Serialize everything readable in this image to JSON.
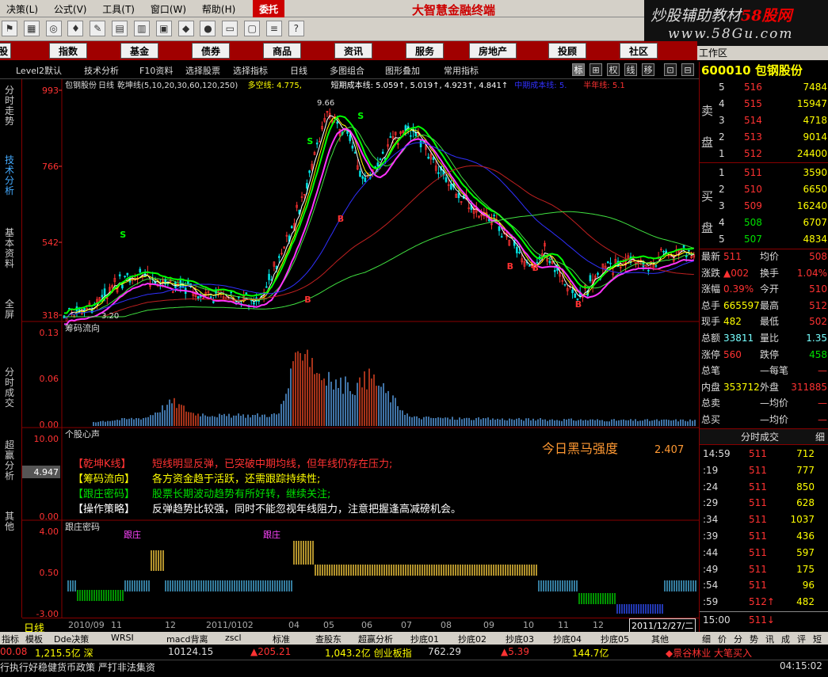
{
  "menu": {
    "items": [
      "决策(L)",
      "公式(V)",
      "工具(T)",
      "窗口(W)",
      "帮助(H)"
    ],
    "entrust": "委托",
    "app_title": "大智慧金融终端"
  },
  "watermark": {
    "line1_a": "炒股辅助教材",
    "line1_b": "58股网",
    "line2": "www.58Gu.com"
  },
  "catbar": {
    "items": [
      "股",
      "指数",
      "基金",
      "债券",
      "商品",
      "资讯",
      "服务",
      "房地产",
      "投顾",
      "社区"
    ],
    "workspace": "工作区"
  },
  "subbar": {
    "items": [
      "Level2默认",
      "技术分析",
      "F10资料",
      "选择股票",
      "选择指标",
      "日线",
      "多图组合",
      "图形叠加",
      "常用指标"
    ],
    "right": [
      "标",
      "⊞",
      "权",
      "线",
      "移",
      "⊡",
      "⊟"
    ],
    "selected_right": "标"
  },
  "lefttabs": [
    "分时走势",
    "技术分析",
    "基本资料",
    "全屏",
    "分时成交",
    "超赢分析",
    "其他"
  ],
  "chart_header": {
    "name": "包钢股份",
    "period": "日线",
    "indicator": "乾坤线(5,10,20,30,60,120,250)",
    "dk": "多空线: 4.775,",
    "cost": "短期成本线: 5.059↑, 5.019↑, 4.923↑, 4.841↑",
    "mid": "中期成本线: 5.",
    "yr": "半年线: 5.1"
  },
  "price_axis": {
    "ticks": [
      "993",
      "766",
      "542",
      "318"
    ],
    "high_label": "9.66",
    "low_label": "3.20"
  },
  "chip": {
    "title": "筹码流向",
    "ticks": [
      "0.13",
      "0.06",
      "0.00"
    ]
  },
  "heart": {
    "title": "个股心声",
    "ticks": [
      "10.00",
      "4.947",
      "0.00"
    ],
    "darkhorse_label": "今日黑马强度",
    "darkhorse_value": "2.407",
    "lines": [
      {
        "tag": "【乾坤K线】",
        "text": "短线明显反弹，已突破中期均线，但年线仍存在压力;",
        "color": "#ff3232"
      },
      {
        "tag": "【筹码流向】",
        "text": "各方资金趋于活跃，还需跟踪持续性;",
        "color": "#ffff00"
      },
      {
        "tag": "【跟庄密码】",
        "text": "股票长期波动趋势有所好转，继续关注;",
        "color": "#00e000"
      },
      {
        "tag": "【操作策略】",
        "text": "反弹趋势比较强，同时不能忽视年线阻力，注意把握逢高减磅机会。",
        "color": "#ffffff"
      }
    ]
  },
  "gzmm": {
    "title": "跟庄密码",
    "ticks": [
      "4.00",
      "0.50",
      "-3.00"
    ],
    "marks": [
      "跟庄",
      "跟庄"
    ]
  },
  "signals": {
    "S": "S",
    "B": "B"
  },
  "datebar": {
    "label": "日线",
    "dates": [
      "2010/09",
      "11",
      "12",
      "2011/0102",
      "04",
      "05",
      "06",
      "07",
      "08",
      "09",
      "10",
      "11",
      "12"
    ],
    "current": "2011/12/27/二"
  },
  "stock": {
    "code": "600010",
    "name": "包钢股份"
  },
  "sell": [
    {
      "n": "5",
      "p": "516",
      "v": "7484"
    },
    {
      "n": "4",
      "p": "515",
      "v": "15947"
    },
    {
      "n": "3",
      "p": "514",
      "v": "4718"
    },
    {
      "n": "2",
      "p": "513",
      "v": "9014"
    },
    {
      "n": "1",
      "p": "512",
      "v": "24400"
    }
  ],
  "buy": [
    {
      "n": "1",
      "p": "511",
      "v": "3590"
    },
    {
      "n": "2",
      "p": "510",
      "v": "6650"
    },
    {
      "n": "3",
      "p": "509",
      "v": "16240"
    },
    {
      "n": "4",
      "p": "508",
      "v": "6707"
    },
    {
      "n": "5",
      "p": "507",
      "v": "4834"
    }
  ],
  "side_labels": {
    "sell": "卖盘",
    "buy": "买盘"
  },
  "quote": [
    {
      "l": "最新",
      "v": "511",
      "l2": "均价",
      "v2": "508"
    },
    {
      "l": "涨跌",
      "v": "▲002",
      "l2": "换手",
      "v2": "1.04%"
    },
    {
      "l": "涨幅",
      "v": "0.39%",
      "l2": "今开",
      "v2": "510"
    },
    {
      "l": "总手",
      "v": "665597",
      "l2": "最高",
      "v2": "512"
    },
    {
      "l": "现手",
      "v": "482",
      "l2": "最低",
      "v2": "502"
    },
    {
      "l": "总额",
      "v": "33811",
      "l2": "量比",
      "v2": "1.35"
    },
    {
      "l": "涨停",
      "v": "560",
      "l2": "跌停",
      "v2": "458"
    },
    {
      "l": "总笔",
      "v": "",
      "l2": "—每笔",
      "v2": "—"
    },
    {
      "l": "内盘",
      "v": "353712",
      "l2": "外盘",
      "v2": "311885"
    },
    {
      "l": "总卖",
      "v": "",
      "l2": "—均价",
      "v2": "—"
    },
    {
      "l": "总买",
      "v": "",
      "l2": "—均价",
      "v2": "—"
    }
  ],
  "ticks_title": "分时成交",
  "ticks_tab": "细",
  "ticks": [
    {
      "t": "14:59",
      "p": "511",
      "v": "712"
    },
    {
      "t": ":19",
      "p": "511",
      "v": "777"
    },
    {
      "t": ":24",
      "p": "511",
      "v": "850"
    },
    {
      "t": ":29",
      "p": "511",
      "v": "628"
    },
    {
      "t": ":34",
      "p": "511",
      "v": "1037"
    },
    {
      "t": ":39",
      "p": "511",
      "v": "436"
    },
    {
      "t": ":44",
      "p": "511",
      "v": "597"
    },
    {
      "t": ":49",
      "p": "511",
      "v": "175"
    },
    {
      "t": ":54",
      "p": "511",
      "v": "96"
    },
    {
      "t": ":59",
      "p": "512↑",
      "v": "482"
    }
  ],
  "close_row": {
    "t": "15:00",
    "p": "511↓"
  },
  "right_tabs": [
    "细",
    "价",
    "分",
    "势",
    "讯",
    "成",
    "评",
    "短"
  ],
  "bottom_tabs": [
    "指标",
    "模板",
    "Dde决策",
    "WRSI",
    "macd背离",
    "zscl",
    "标准",
    "查股东",
    "超赢分析",
    "抄底01",
    "抄底02",
    "抄底03",
    "抄底04",
    "抄底05",
    "其他"
  ],
  "status": {
    "items": [
      {
        "t": "00.08",
        "c": "#ff3232"
      },
      {
        "t": "1,215.5亿 深",
        "c": "#ffff00"
      },
      {
        "t": "10124.15",
        "c": "#ddd"
      },
      {
        "t": "▲205.21",
        "c": "#ff3232"
      },
      {
        "t": "1,043.2亿 创业板指",
        "c": "#ffff00"
      },
      {
        "t": "762.29",
        "c": "#ddd"
      },
      {
        "t": "▲5.39",
        "c": "#ff3232"
      },
      {
        "t": "144.7亿",
        "c": "#ffff00"
      },
      {
        "t": "◆景谷林业 大笔买入",
        "c": "#ff3232"
      }
    ],
    "line2": "行执行好稳健货币政策 严打非法集资",
    "time": "04:15:02"
  },
  "colors": {
    "up": "#ff3232",
    "down": "#00e0e0",
    "ma_green": "#00ff00",
    "ma_magenta": "#ff33ff",
    "ma_white": "#ffffff",
    "ma_yellow": "#ffff00",
    "ma_blue": "#3030ff",
    "ma_red": "#c02020",
    "ma_lime": "#40e040"
  }
}
